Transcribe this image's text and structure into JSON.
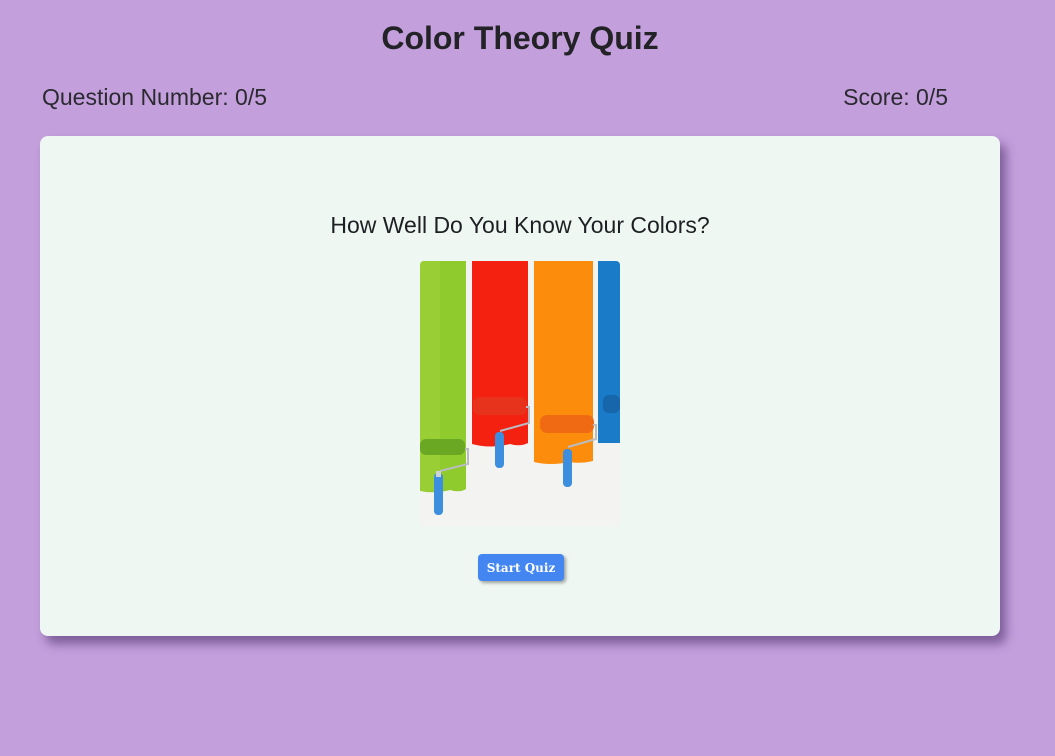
{
  "header": {
    "title": "Color Theory Quiz"
  },
  "stats": {
    "question_number_label": "Question Number: 0/5",
    "score_label": "Score: 0/5"
  },
  "card": {
    "question": "How Well Do You Know Your Colors?",
    "image": {
      "description_icon": "paint-rollers-image",
      "stripe_colors": [
        "#8fcb2d",
        "#f42010",
        "#fb8c0c",
        "#1a7cc8"
      ]
    },
    "start_button_label": "Start Quiz"
  },
  "colors": {
    "background": "#c39fdc",
    "card": "#eff7f3",
    "accent": "#4486f1"
  }
}
